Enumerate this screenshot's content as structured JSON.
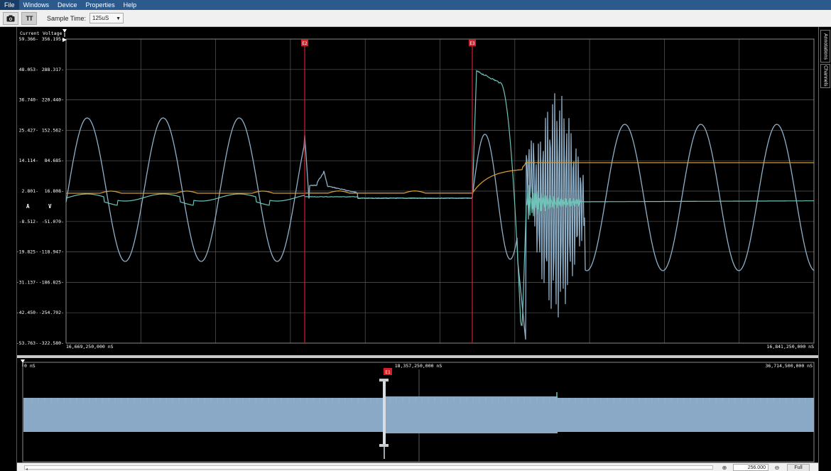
{
  "menu": {
    "items": [
      "File",
      "Windows",
      "Device",
      "Properties",
      "Help"
    ]
  },
  "toolbar": {
    "camera_icon": "camera-icon",
    "text_tool_label": "TT",
    "sample_time_label": "Sample Time:",
    "sample_time_value": "125uS"
  },
  "side_tabs": {
    "annotations": "Annotations",
    "channels": "Channels"
  },
  "main_plot": {
    "current_header": "Current",
    "voltage_header": "Voltage",
    "current_unit": "A",
    "voltage_unit": "V",
    "current_ticks": [
      "59.366",
      "48.053",
      "36.740",
      "25.427",
      "14.114",
      "2.801",
      "-8.512",
      "-19.825",
      "-31.137",
      "-42.450",
      "-53.763"
    ],
    "voltage_ticks": [
      "356.195",
      "288.317",
      "220.440",
      "152.562",
      "84.685",
      "16.808",
      "-51.070",
      "-118.947",
      "-186.825",
      "-254.702",
      "-322.580"
    ],
    "x_start_label": "16,669,250,000 nS",
    "x_end_label": "16,841,250,000 nS",
    "marker_labels": [
      "E2",
      "E3"
    ],
    "colors": {
      "voltage": "#8fb0c8",
      "current": "#6ec4b8",
      "power": "#d49a30",
      "marker": "#d0202a",
      "grid": "#5a5a5a"
    }
  },
  "overview": {
    "x_start_label": "0 nS",
    "x_mid_label": "18,357,250,000 nS",
    "x_end_label": "36,714,500,000 nS",
    "marker_label": "E1",
    "fill_color": "#8aa9c6"
  },
  "zoom": {
    "value": "256.000",
    "full_label": "Full"
  }
}
